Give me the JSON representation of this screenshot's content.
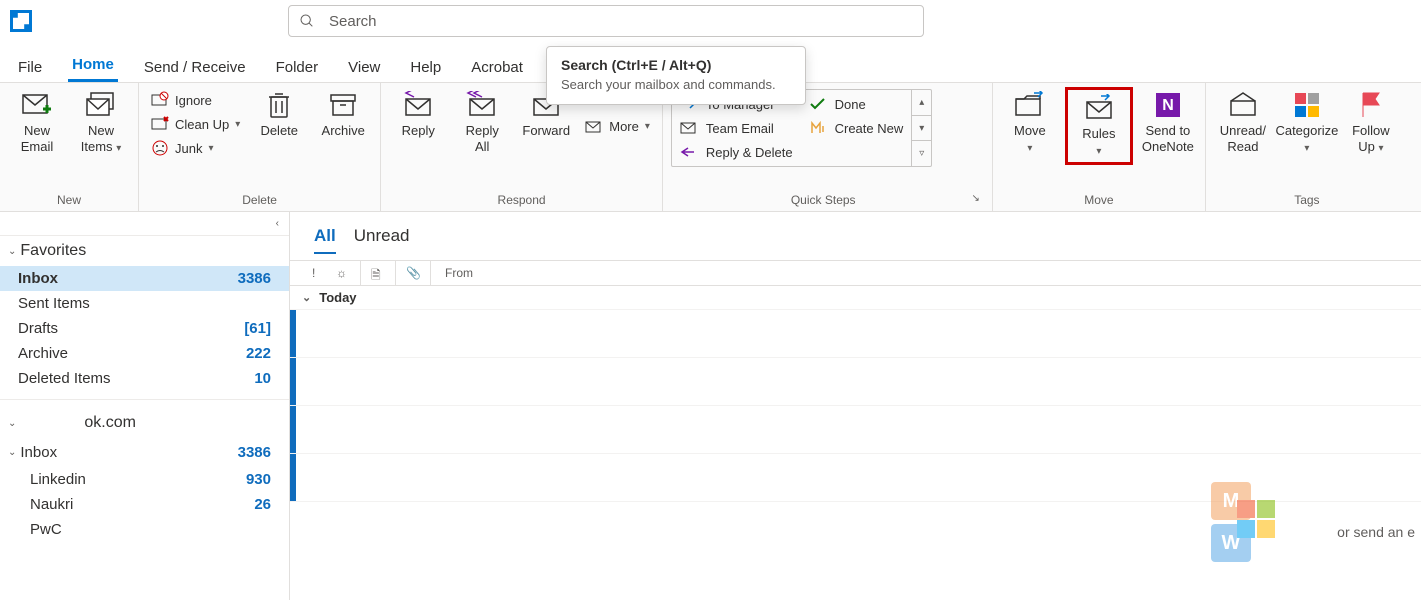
{
  "search": {
    "placeholder": "Search"
  },
  "tooltip": {
    "title": "Search (Ctrl+E / Alt+Q)",
    "body": "Search your mailbox and commands."
  },
  "menu": {
    "file": "File",
    "home": "Home",
    "sendreceive": "Send / Receive",
    "folder": "Folder",
    "view": "View",
    "help": "Help",
    "acrobat": "Acrobat"
  },
  "ribbon": {
    "new": {
      "email": "New\nEmail",
      "items": "New\nItems",
      "group": "New"
    },
    "delete": {
      "ignore": "Ignore",
      "cleanup": "Clean Up",
      "junk": "Junk",
      "delete": "Delete",
      "archive": "Archive",
      "group": "Delete"
    },
    "respond": {
      "reply": "Reply",
      "replyall": "Reply\nAll",
      "forward": "Forward",
      "more": "More",
      "group": "Respond"
    },
    "quicksteps": {
      "tomanager": "To Manager",
      "teamemail": "Team Email",
      "replydelete": "Reply & Delete",
      "done": "Done",
      "createnew": "Create New",
      "group": "Quick Steps"
    },
    "move": {
      "move": "Move",
      "rules": "Rules",
      "onenote": "Send to\nOneNote",
      "group": "Move"
    },
    "tags": {
      "unread": "Unread/\nRead",
      "categorize": "Categorize",
      "followup": "Follow\nUp",
      "group": "Tags"
    }
  },
  "nav": {
    "favorites": "Favorites",
    "inbox": {
      "label": "Inbox",
      "count": "3386"
    },
    "sent": {
      "label": "Sent Items"
    },
    "drafts": {
      "label": "Drafts",
      "count": "[61]"
    },
    "archive": {
      "label": "Archive",
      "count": "222"
    },
    "deleted": {
      "label": "Deleted Items",
      "count": "10"
    },
    "account": "ok.com",
    "acct_inbox": {
      "label": "Inbox",
      "count": "3386"
    },
    "linkedin": {
      "label": "Linkedin",
      "count": "930"
    },
    "naukri": {
      "label": "Naukri",
      "count": "26"
    },
    "pwc": {
      "label": "PwC"
    }
  },
  "list": {
    "all": "All",
    "unread": "Unread",
    "from": "From",
    "today": "Today",
    "hint": "or send an e"
  }
}
